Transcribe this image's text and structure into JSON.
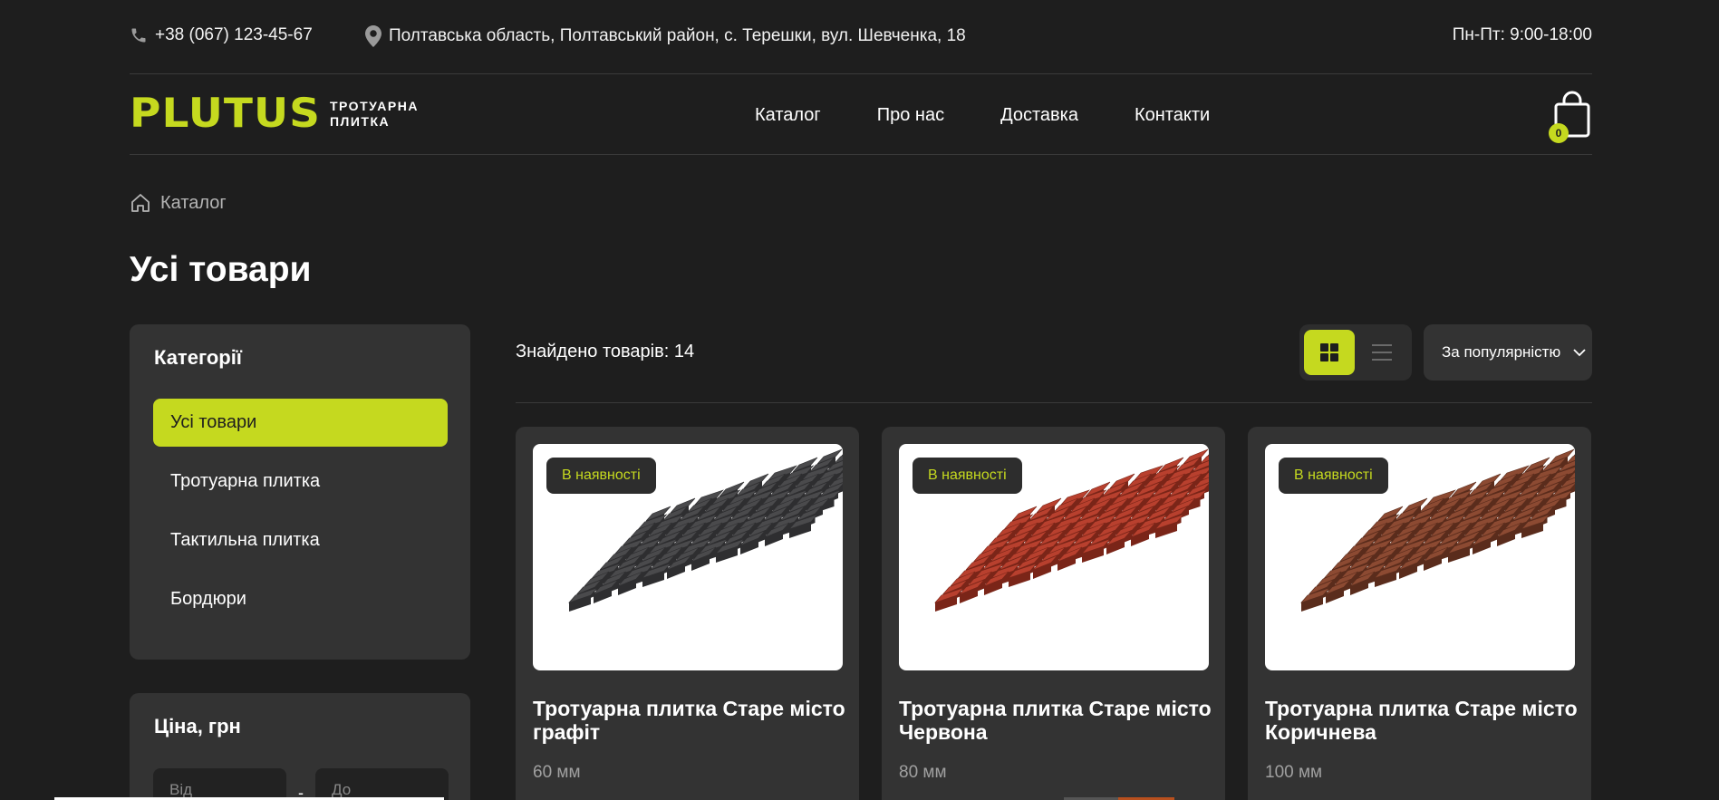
{
  "topbar": {
    "phone": "+38 (067) 123-45-67",
    "address": "Полтавська область, Полтавський район, с. Терешки, вул. Шевченка, 18",
    "hours": "Пн-Пт: 9:00-18:00"
  },
  "header": {
    "logo_word": "PLUTUS",
    "logo_sub_line1": "ТРОТУАРНА",
    "logo_sub_line2": "ПЛИТКА",
    "nav": [
      "Каталог",
      "Про нас",
      "Доставка",
      "Контакти"
    ],
    "cart_count": "0"
  },
  "breadcrumb": {
    "label": "Каталог"
  },
  "page_title": "Усі товари",
  "sidebar": {
    "categories_title": "Категорії",
    "categories": [
      "Усі товари",
      "Тротуарна плитка",
      "Тактильна плитка",
      "Бордюри"
    ],
    "active_category": "Усі товари",
    "price_title": "Ціна, грн",
    "price_from_placeholder": "Від",
    "price_to_placeholder": "До",
    "price_dash": "-"
  },
  "toolbar": {
    "found_text": "Знайдено товарів: 14",
    "sort_label": "За популярністю",
    "active_view": "grid"
  },
  "products": [
    {
      "badge": "В наявності",
      "name": "Тротуарна плитка Старе місто графіт",
      "size": "60 мм",
      "tile_color": "#4a4a4c",
      "tile_edge": "#2e2e30"
    },
    {
      "badge": "В наявності",
      "name": "Тротуарна плитка Старе місто Червона",
      "size": "80 мм",
      "tile_color": "#b8402e",
      "tile_edge": "#7a2518"
    },
    {
      "badge": "В наявності",
      "name": "Тротуарна плитка Старе місто Коричнева",
      "size": "100 мм",
      "tile_color": "#8c4a32",
      "tile_edge": "#5a2c1c"
    }
  ],
  "colors": {
    "accent": "#c5d91f",
    "background": "#1e1e1e",
    "panel": "#333333"
  }
}
